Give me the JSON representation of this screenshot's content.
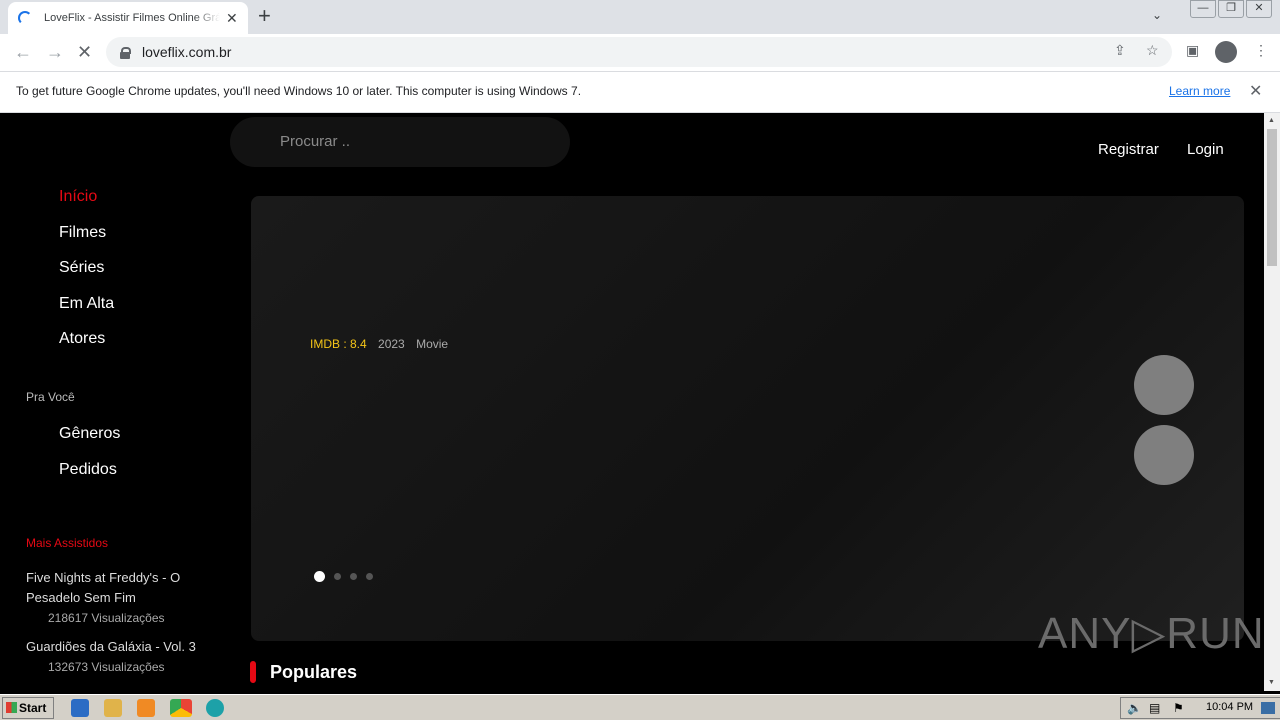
{
  "browser": {
    "tab_title": "LoveFlix - Assistir Filmes Online Grátis",
    "tab_close": "✕",
    "new_tab": "+",
    "url": "loveflix.com.br",
    "window_controls": [
      "—",
      "❐",
      "✕"
    ]
  },
  "infobar": {
    "message": "To get future Google Chrome updates, you'll need Windows 10 or later. This computer is using Windows 7.",
    "link": "Learn more",
    "close": "✕"
  },
  "site": {
    "search_placeholder": "Procurar ..",
    "top_links": {
      "register": "Registrar",
      "login": "Login"
    },
    "nav": [
      "Início",
      "Filmes",
      "Séries",
      "Em Alta",
      "Atores"
    ],
    "section_for_you": "Pra Você",
    "nav_for_you": [
      "Gêneros",
      "Pedidos"
    ],
    "most_watched_label": "Mais Assistidos",
    "most_watched": [
      {
        "title": "Five Nights at Freddy's - O Pesadelo Sem Fim",
        "views": "218617 Visualizações"
      },
      {
        "title": "Guardiões da Galáxia - Vol. 3",
        "views": "132673 Visualizações"
      }
    ],
    "hero": {
      "imdb": "IMDB : 8.4",
      "year": "2023",
      "type": "Movie",
      "slide_count": 4,
      "active_slide": 1
    },
    "populares": "Populares"
  },
  "watermark": "ANY▷RUN",
  "taskbar": {
    "start": "Start",
    "clock": "10:04 PM"
  },
  "colors": {
    "accent": "#e50914",
    "imdb": "#f5c518",
    "background": "#000000"
  }
}
